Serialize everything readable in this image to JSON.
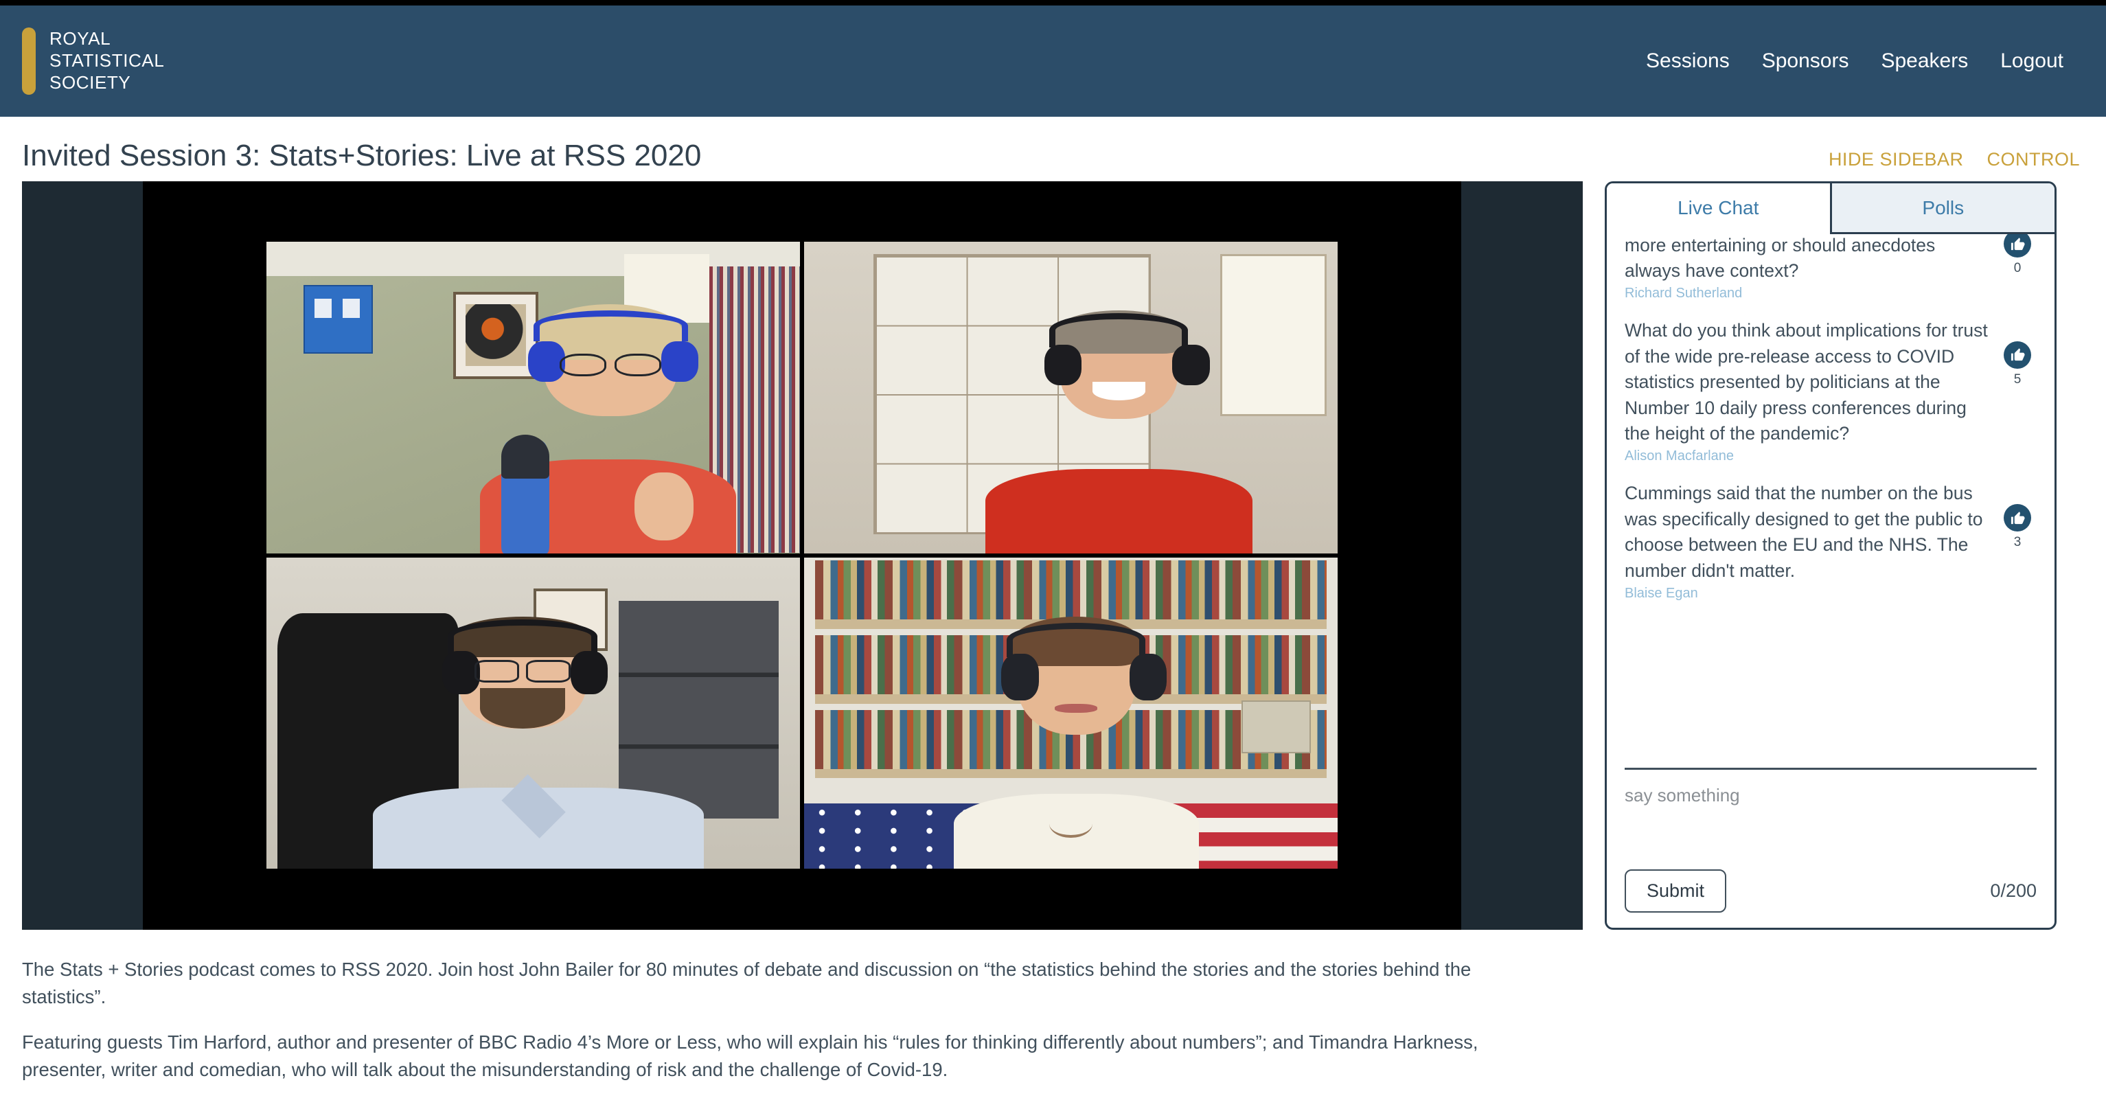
{
  "header": {
    "brand": {
      "line1": "ROYAL",
      "line2": "STATISTICAL",
      "line3": "SOCIETY",
      "accent_color": "#c9a13b",
      "bg_color": "#2c4d69"
    },
    "nav": [
      {
        "label": "Sessions"
      },
      {
        "label": "Sponsors"
      },
      {
        "label": "Speakers"
      },
      {
        "label": "Logout"
      }
    ]
  },
  "page": {
    "title": "Invited Session 3: Stats+Stories: Live at RSS 2020",
    "actions": [
      {
        "label": "HIDE SIDEBAR"
      },
      {
        "label": "CONTROL"
      }
    ],
    "action_color": "#c9a13b"
  },
  "video": {
    "participants": [
      {
        "name": "participant-top-left",
        "active_speaker": true
      },
      {
        "name": "participant-top-right",
        "active_speaker": false
      },
      {
        "name": "participant-bottom-left",
        "active_speaker": false
      },
      {
        "name": "participant-bottom-right",
        "active_speaker": false
      }
    ],
    "active_border_color": "#e9ef86",
    "stage_bg": "#1e2a33"
  },
  "chat": {
    "tabs": [
      {
        "label": "Live Chat",
        "active": true
      },
      {
        "label": "Polls",
        "active": false
      }
    ],
    "messages": [
      {
        "text": "public perception. Should official stats be more entertaining or should anecdotes always have context?",
        "author": "Richard Sutherland",
        "votes": "0",
        "clipped_top": true
      },
      {
        "text": "What do you think about implications for trust of the wide pre-release access to COVID statistics presented by politicians at the Number 10 daily press conferences during the height of the pandemic?",
        "author": "Alison Macfarlane",
        "votes": "5",
        "clipped_top": false
      },
      {
        "text": "Cummings said that the number on the bus was specifically designed to get the public to choose between the EU and the NHS. The number didn't matter.",
        "author": "Blaise Egan",
        "votes": "3",
        "clipped_top": false
      }
    ],
    "compose": {
      "placeholder": "say something",
      "value": "",
      "submit_label": "Submit",
      "char_count": "0/200"
    }
  },
  "description": {
    "paragraphs": [
      "The Stats + Stories podcast comes to RSS 2020. Join host John Bailer for 80 minutes of debate and discussion on “the statistics behind the stories and the stories behind the statistics”.",
      "Featuring guests Tim Harford, author and presenter of BBC Radio 4’s More or Less, who will explain his “rules for thinking differently about numbers”; and Timandra Harkness, presenter, writer and comedian, who will talk about the misunderstanding of risk and the challenge of Covid-19."
    ]
  }
}
